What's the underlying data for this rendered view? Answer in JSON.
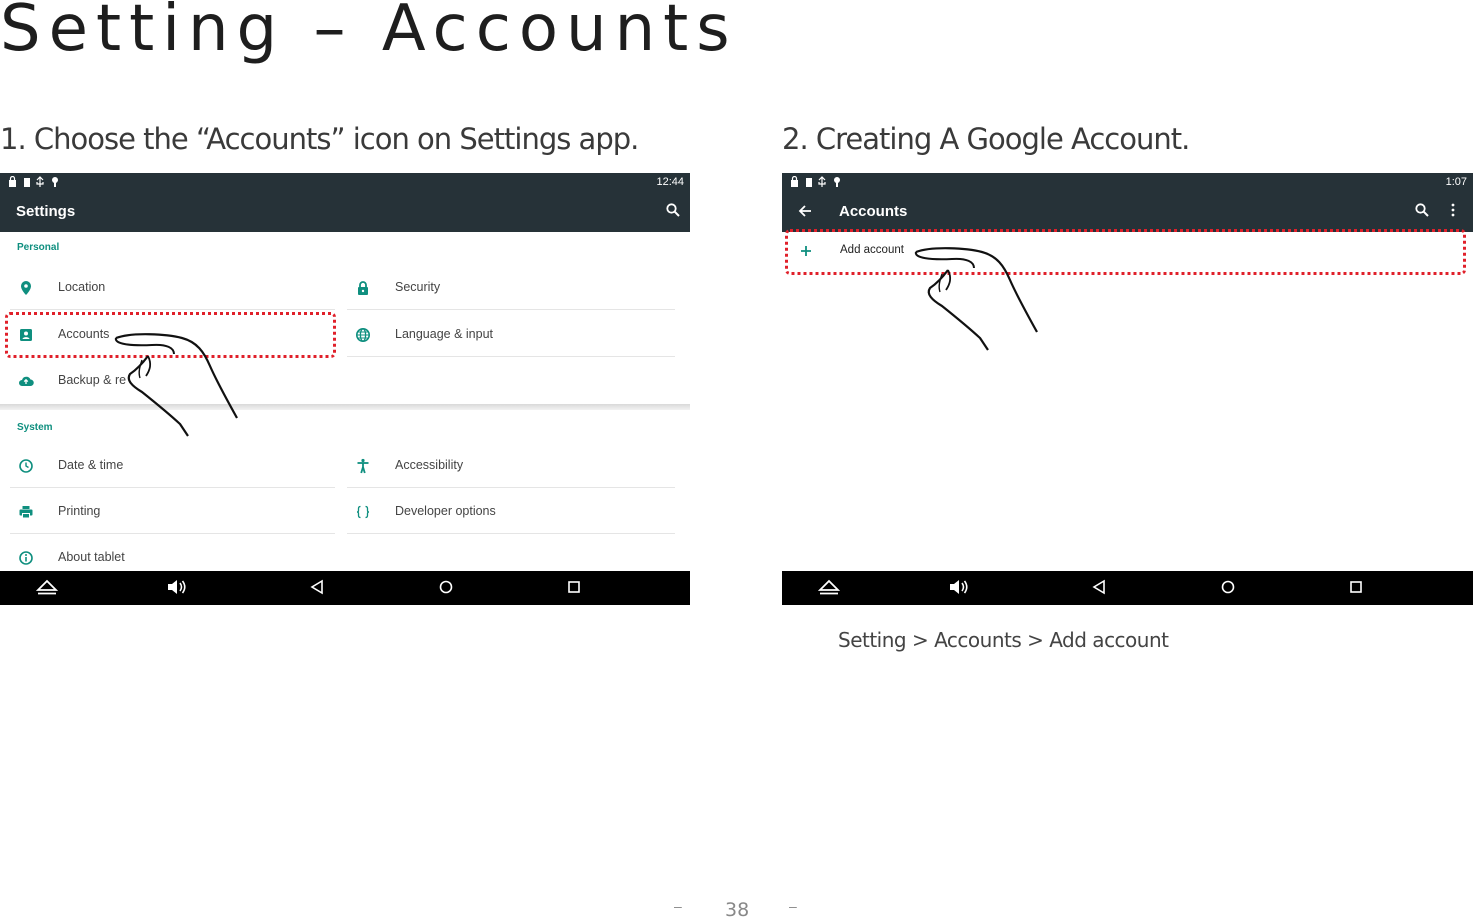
{
  "page": {
    "title": "Setting – Accounts",
    "page_number": "38",
    "footer_dash": "–"
  },
  "step1": {
    "heading": "1. Choose the “Accounts” icon on Settings app.",
    "clock": "12:44",
    "app_title": "Settings",
    "personal_header": "Personal",
    "system_header": "System",
    "items": {
      "location": "Location",
      "security": "Security",
      "accounts": "Accounts",
      "language": "Language & input",
      "backup": "Backup & re",
      "date_time": "Date & time",
      "accessibility": "Accessibility",
      "printing": "Printing",
      "developer": "Developer options",
      "about": "About tablet"
    }
  },
  "step2": {
    "heading": "2. Creating A Google Account.",
    "clock": "1:07",
    "app_title": "Accounts",
    "add_account": "Add account",
    "breadcrumb": "Setting > Accounts > Add account"
  },
  "colors": {
    "appbar": "#263238",
    "accent_teal": "#0f8f7f",
    "highlight_red": "#e0202a",
    "navbar": "#000000"
  }
}
